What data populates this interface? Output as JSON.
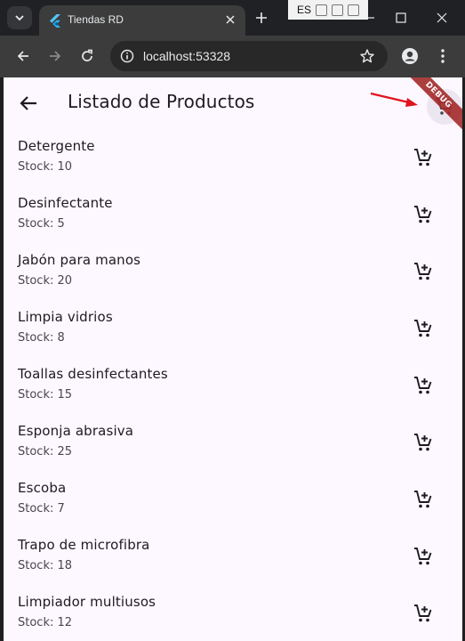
{
  "browser": {
    "tab_title": "Tiendas RD",
    "url": "localhost:53328",
    "ime_language": "ES"
  },
  "app": {
    "title": "Listado de Productos",
    "debug_label": "DEBUG"
  },
  "products": [
    {
      "name": "Detergente",
      "stock": "Stock: 10"
    },
    {
      "name": "Desinfectante",
      "stock": "Stock: 5"
    },
    {
      "name": "Jabón para manos",
      "stock": "Stock: 20"
    },
    {
      "name": "Limpia vidrios",
      "stock": "Stock: 8"
    },
    {
      "name": "Toallas desinfectantes",
      "stock": "Stock: 15"
    },
    {
      "name": "Esponja abrasiva",
      "stock": "Stock: 25"
    },
    {
      "name": "Escoba",
      "stock": "Stock: 7"
    },
    {
      "name": "Trapo de microfibra",
      "stock": "Stock: 18"
    },
    {
      "name": "Limpiador multiusos",
      "stock": "Stock: 12"
    }
  ],
  "colors": {
    "app_background": "#fdf7ff",
    "annotation_arrow": "#e0141e",
    "debug_ribbon": "#a42a2a"
  },
  "icons": {
    "product_action": "add-shopping-cart-icon",
    "appbar_action": "shopping-cart-icon"
  }
}
